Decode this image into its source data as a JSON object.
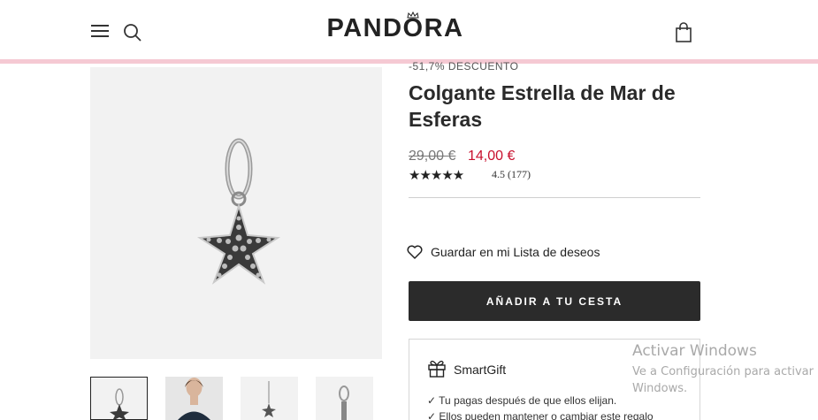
{
  "header": {
    "logo_text": "PANDORA",
    "menu_icon": "hamburger-menu-icon",
    "search_icon": "search-icon",
    "bag_icon": "shopping-bag-icon",
    "stripe_color": "#f5c9d3"
  },
  "product": {
    "discount": "-51,7% DESCUENTO",
    "title": "Colgante Estrella de Mar de Esferas",
    "old_price": "29,00 €",
    "new_price": "14,00 €",
    "new_price_color": "#c8102e",
    "stars": "★★★★★",
    "rating": 4.5,
    "rating_text": "4.5  (177)",
    "wishlist_label": "Guardar en mi Lista de deseos",
    "add_to_cart_label": "AÑADIR A TU CESTA"
  },
  "thumbnails": [
    {
      "subject": "starfish-charm",
      "active": true
    },
    {
      "subject": "model-wearing-necklace",
      "active": false
    },
    {
      "subject": "starfish-charm-small",
      "active": false
    },
    {
      "subject": "charm-side-view",
      "active": false
    }
  ],
  "smartgift": {
    "title": "SmartGift",
    "line1": "✓ Tu pagas después de que ellos elijan.",
    "line2": "✓ Ellos pueden mantener o cambiar este regalo"
  },
  "watermark": {
    "title": "Activar Windows",
    "subtitle": "Ve a Configuración para activar Windows."
  }
}
